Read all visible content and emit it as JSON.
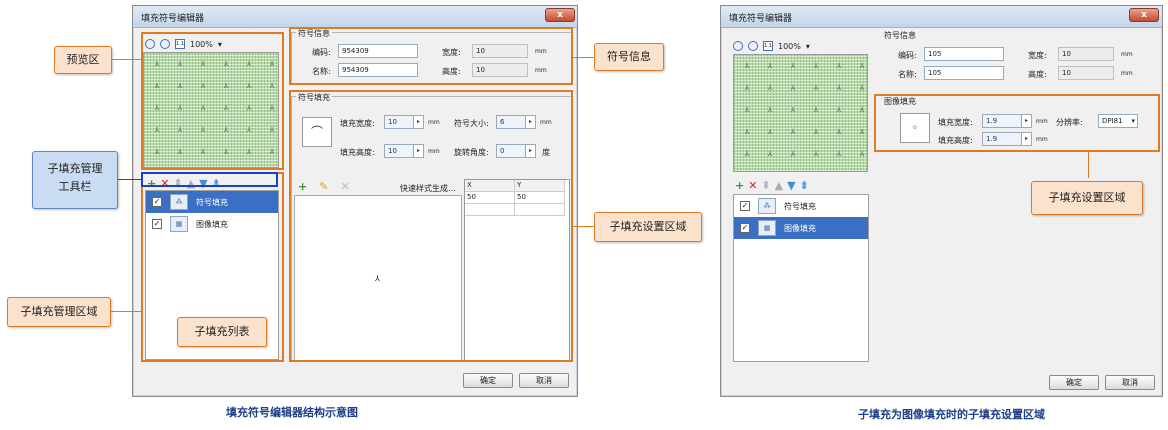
{
  "left_dialog": {
    "title": "填充符号编辑器",
    "close_label": "x",
    "zoom_level": "100%",
    "zoom_in_icon": "zoom-in-icon",
    "zoom_out_icon": "zoom-out-icon",
    "actual_size_label": "1:1",
    "symbol_info": {
      "group_label": "符号信息",
      "code_label": "编码:",
      "code_value": "954309",
      "name_label": "名称:",
      "name_value": "954309",
      "width_label": "宽度:",
      "width_value": "10",
      "height_label": "高度:",
      "height_value": "10",
      "unit": "mm"
    },
    "symbol_fill": {
      "group_label": "符号填充",
      "fill_width_label": "填充宽度:",
      "fill_width_value": "10",
      "fill_height_label": "填充高度:",
      "fill_height_value": "10",
      "symbol_size_label": "符号大小:",
      "symbol_size_value": "6",
      "rotation_label": "旋转角度:",
      "rotation_value": "0",
      "unit": "mm",
      "degree_unit": "度",
      "quick_style_label": "快速样式生成...",
      "table": {
        "headers": [
          "X",
          "Y"
        ],
        "rows": [
          [
            "50",
            "50"
          ]
        ]
      }
    },
    "fill_list": [
      {
        "label": "符号填充",
        "checked": true,
        "selected": true
      },
      {
        "label": "图像填充",
        "checked": true,
        "selected": false
      }
    ],
    "ok_label": "确定",
    "cancel_label": "取消"
  },
  "right_dialog": {
    "title": "填充符号编辑器",
    "close_label": "x",
    "zoom_level": "100%",
    "actual_size_label": "1:1",
    "symbol_info": {
      "group_label": "符号信息",
      "code_label": "编码:",
      "code_value": "105",
      "name_label": "名称:",
      "name_value": "105",
      "width_label": "宽度:",
      "width_value": "10",
      "height_label": "高度:",
      "height_value": "10",
      "unit": "mm"
    },
    "image_fill": {
      "group_label": "图像填充",
      "fill_width_label": "填充宽度:",
      "fill_width_value": "1.9",
      "fill_height_label": "填充高度:",
      "fill_height_value": "1.9",
      "resolution_label": "分辨率:",
      "resolution_value": "DPI81",
      "unit": "mm"
    },
    "fill_list": [
      {
        "label": "符号填充",
        "checked": true,
        "selected": false
      },
      {
        "label": "图像填充",
        "checked": true,
        "selected": true
      }
    ],
    "ok_label": "确定",
    "cancel_label": "取消"
  },
  "annotations": {
    "preview_area": "预览区",
    "symbol_info": "符号信息",
    "subfill_toolbar_line1": "子填充管理",
    "subfill_toolbar_line2": "工具栏",
    "subfill_settings": "子填充设置区域",
    "subfill_manage_area": "子填充管理区域",
    "subfill_list": "子填充列表",
    "subfill_settings_right": "子填充设置区域"
  },
  "captions": {
    "left": "填充符号编辑器结构示意图",
    "right": "子填充为图像填充时的子填充设置区域"
  },
  "colors": {
    "callout_orange": "#e07a22",
    "callout_fill": "#fbe2cc",
    "toolbar_frame_blue": "#1a3fd0",
    "selection_blue": "#3a6fc4"
  }
}
